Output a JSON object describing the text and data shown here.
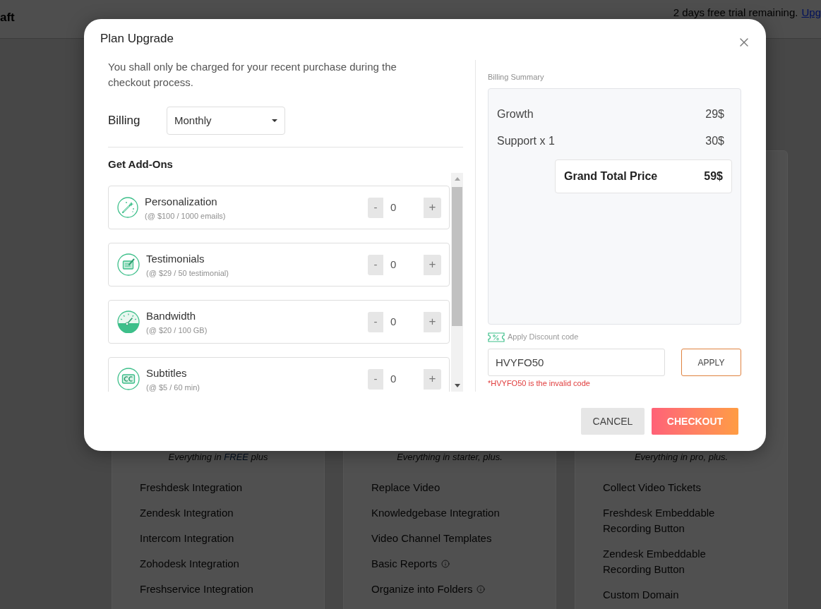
{
  "top_bar": {
    "title": "aft",
    "trial_notice": "2 days free trial remaining.",
    "upgrade_link": "Upg"
  },
  "plans": [
    {
      "intro": "Everything in",
      "highlight": "FREE",
      "intro_end": "plus",
      "features": [
        {
          "label": "Freshdesk Integration",
          "info": false
        },
        {
          "label": "Zendesk Integration",
          "info": false
        },
        {
          "label": "Intercom Integration",
          "info": false
        },
        {
          "label": "Zohodesk Integration",
          "info": false
        },
        {
          "label": "Freshservice Integration",
          "info": false
        }
      ]
    },
    {
      "intro": "Everything in starter, plus.",
      "features": [
        {
          "label": "Replace Video",
          "info": false
        },
        {
          "label": "Knowledgebase Integration",
          "info": false
        },
        {
          "label": "Video Channel Templates",
          "info": false
        },
        {
          "label": "Basic Reports",
          "info": true
        },
        {
          "label": "Organize into Folders",
          "info": true
        }
      ]
    },
    {
      "intro": "Everything in pro, plus.",
      "features": [
        {
          "label": "Collect Video Tickets",
          "info": false
        },
        {
          "label": "Freshdesk Embeddable Recording Button",
          "info": false
        },
        {
          "label": "Zendesk Embeddable Recording Button",
          "info": false
        },
        {
          "label": "Custom Domain",
          "info": false
        }
      ]
    }
  ],
  "dialog": {
    "title": "Plan Upgrade",
    "note": "You shall only be charged for your recent purchase during the checkout process.",
    "billing": {
      "label": "Billing",
      "value": "Monthly"
    },
    "addons_title": "Get Add-Ons",
    "addons": [
      {
        "name": "Personalization",
        "price": "(@ $100 / 1000 emails)",
        "decrement": "-",
        "quantity": "0",
        "increment": "+"
      },
      {
        "name": "Testimonials",
        "price": "(@ $29 / 50 testimonial)",
        "decrement": "-",
        "quantity": "0",
        "increment": "+"
      },
      {
        "name": "Bandwidth",
        "price": "(@ $20 / 100 GB)",
        "decrement": "-",
        "quantity": "0",
        "increment": "+"
      },
      {
        "name": "Subtitles",
        "price": "(@ $5 / 60 min)",
        "decrement": "-",
        "quantity": "0",
        "increment": "+"
      }
    ],
    "summary": {
      "title": "Billing Summary",
      "lines": [
        {
          "label": "Growth",
          "amount": "29$"
        },
        {
          "label": "Support x 1",
          "amount": "30$"
        }
      ],
      "total": {
        "label": "Grand Total Price",
        "amount": "59$"
      }
    },
    "discount": {
      "label": "Apply Discount code",
      "value": "HVYFO50",
      "apply": "APPLY",
      "error": "*HVYFO50 is the invalid code"
    },
    "buttons": [
      {
        "kind": "secondary",
        "label": "CANCEL"
      },
      {
        "kind": "primary",
        "label": "CHECKOUT"
      }
    ]
  }
}
